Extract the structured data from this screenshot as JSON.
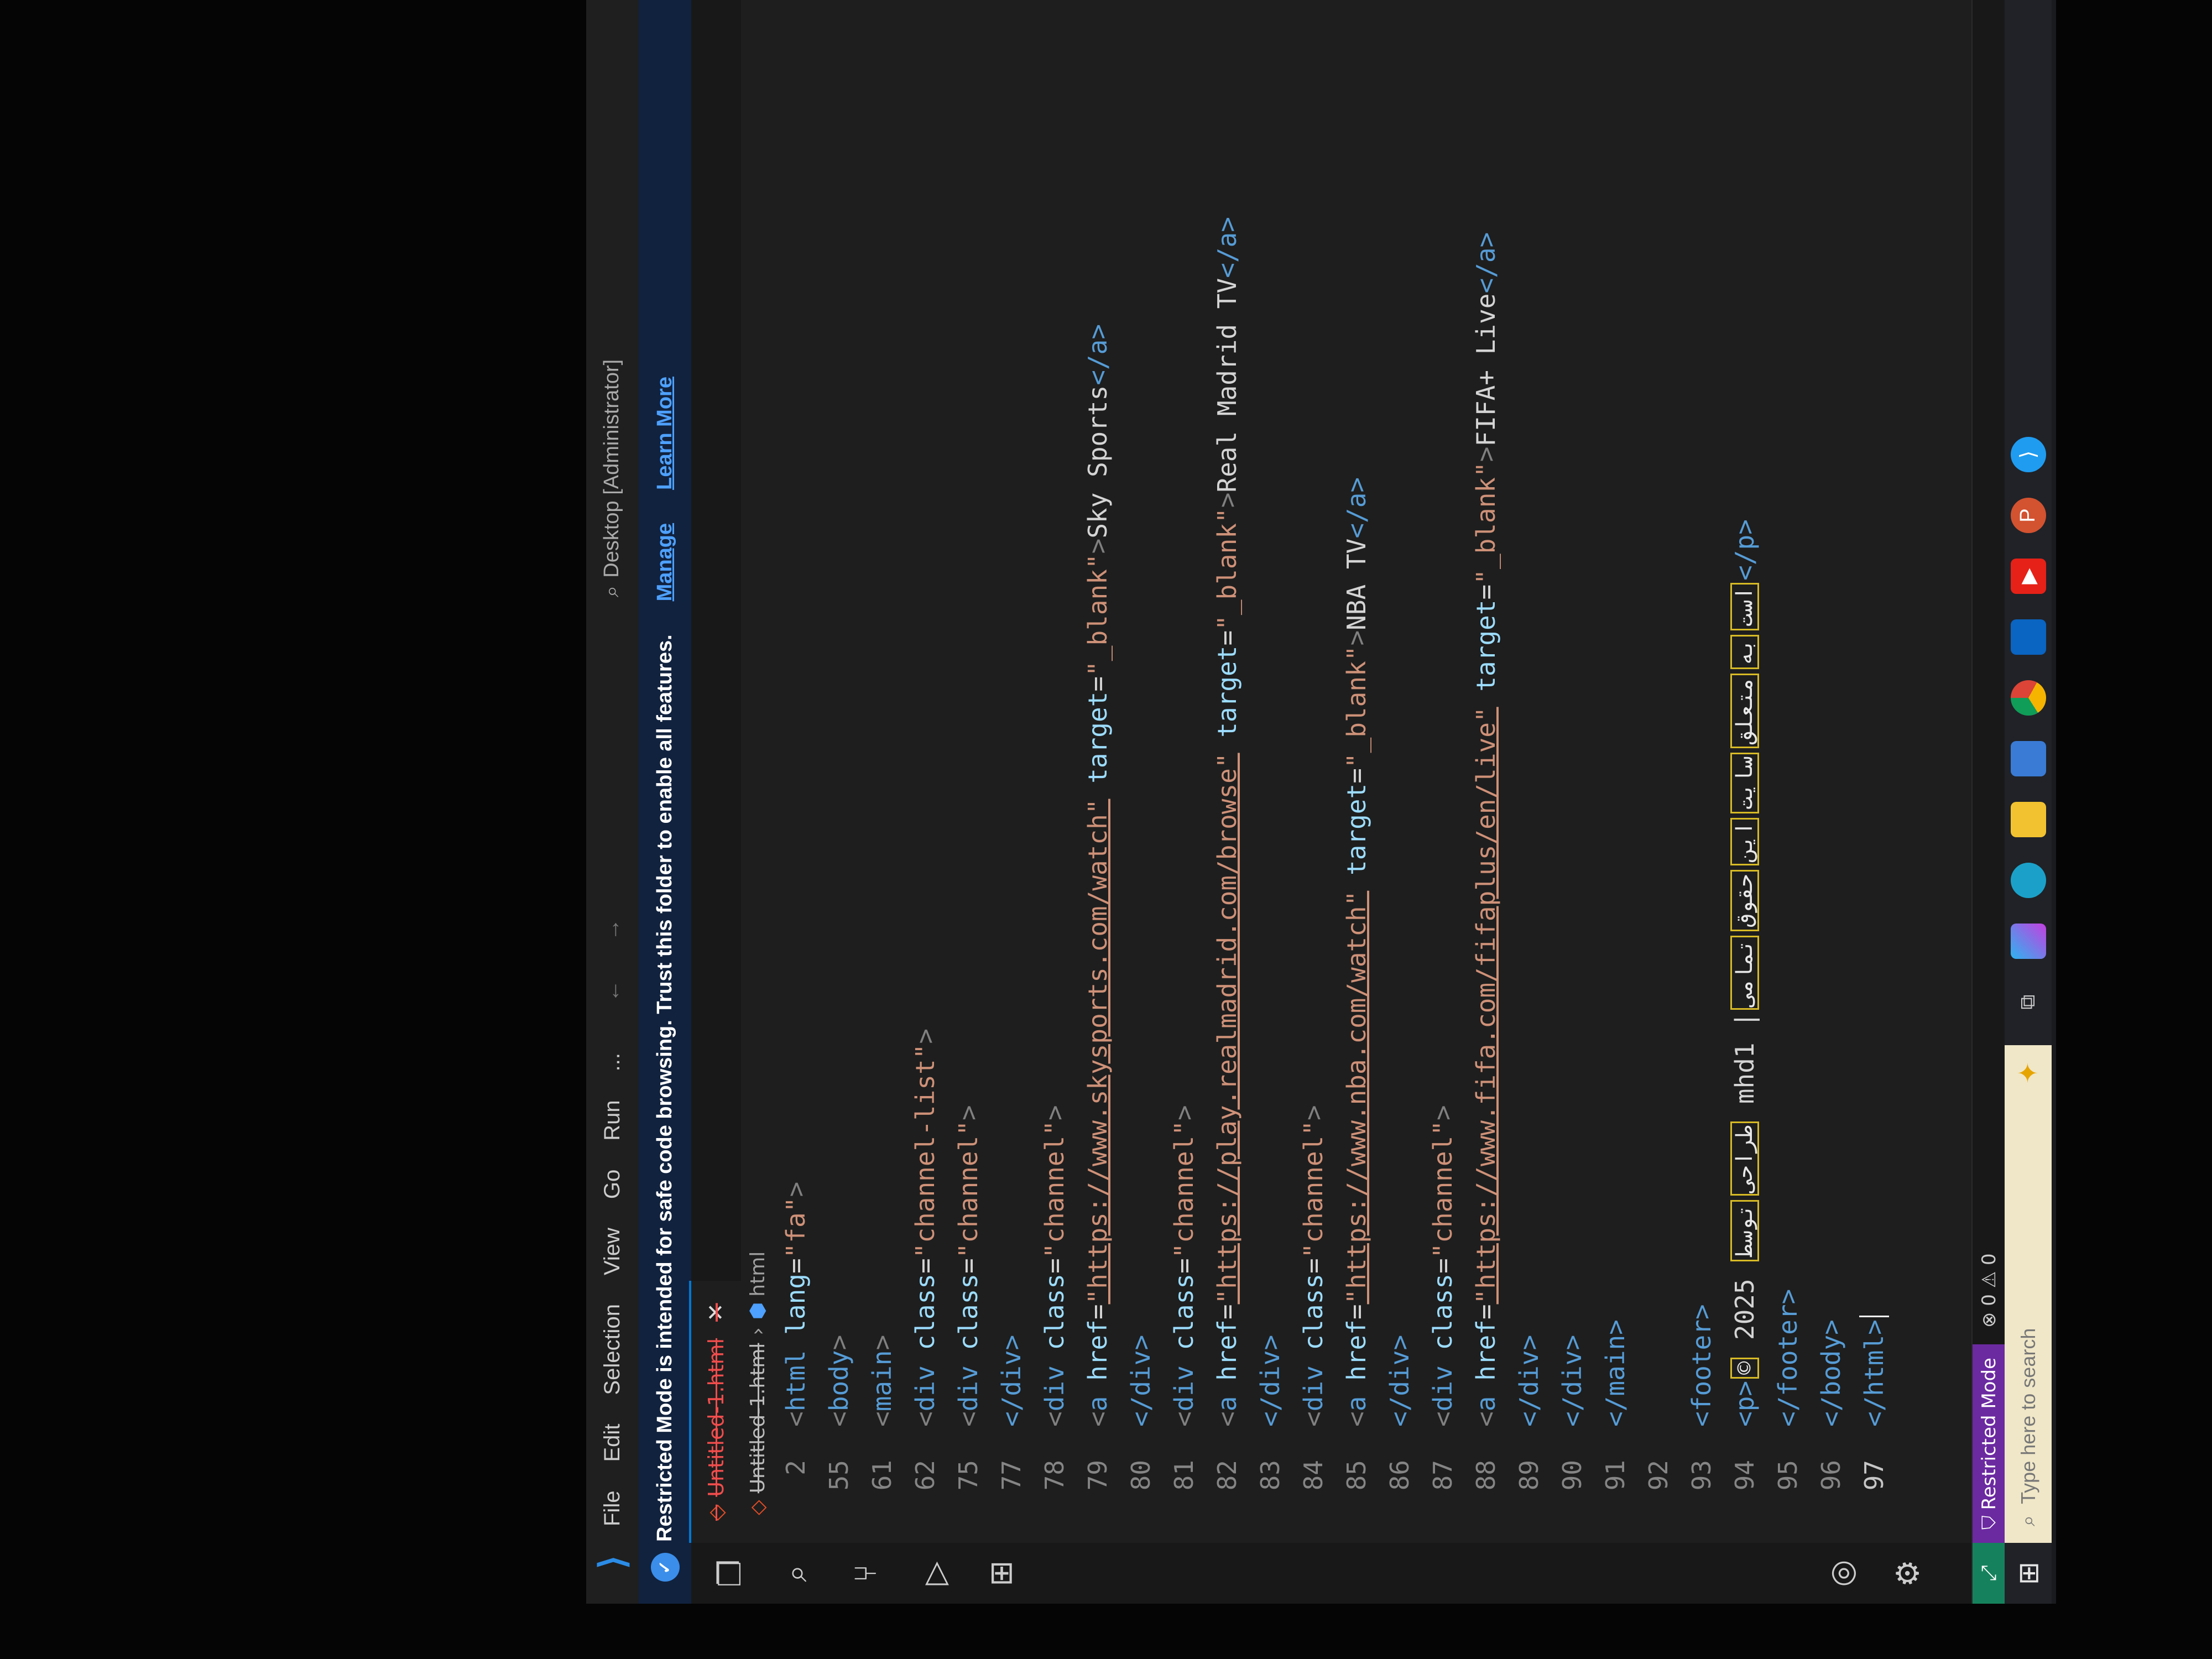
{
  "titlebar": {
    "menu": [
      "File",
      "Edit",
      "Selection",
      "View",
      "Go",
      "Run",
      "..."
    ],
    "nav_arrows": "← →",
    "search": "Desktop [Administrator]"
  },
  "banner": {
    "message": "Restricted Mode is intended for safe code browsing. Trust this folder to enable all features.",
    "manage": "Manage",
    "learn_more": "Learn More"
  },
  "activity_icons": [
    "explorer-icon",
    "search-icon",
    "source-control-icon",
    "run-debug-icon",
    "extensions-icon",
    "account-icon",
    "settings-icon"
  ],
  "editor": {
    "tab_label": "Untitled-1.html",
    "tab_close": "✕",
    "breadcrumb_file": "Untitled-1.html",
    "breadcrumb_sep": "›",
    "breadcrumb_node": "html"
  },
  "code": {
    "line_numbers": [
      "2",
      "55",
      "61",
      "62",
      "75",
      "77",
      "78",
      "79",
      "80",
      "81",
      "82",
      "83",
      "84",
      "85",
      "86",
      "87",
      "88",
      "89",
      "90",
      "91",
      "92",
      "93",
      "94",
      "95",
      "96",
      "97"
    ],
    "l2a": "<",
    "l2b": "html ",
    "l2c": "lang",
    "l2d": "=",
    "l2e": "\"fa\"",
    "l2f": ">",
    "l55a": "<",
    "l55b": "body",
    "l55c": ">",
    "l61a": "<",
    "l61b": "main",
    "l61c": ">",
    "l62a": "<",
    "l62b": "div ",
    "l62c": "class",
    "l62d": "=",
    "l62e": "\"channel-list\"",
    "l62f": ">",
    "l75a": "<",
    "l75b": "div ",
    "l75c": "class",
    "l75d": "=",
    "l75e": "\"channel\"",
    "l75f": ">",
    "close_div": "</div>",
    "l78a": "<",
    "l78b": "div ",
    "l78c": "class",
    "l78d": "=",
    "l78e": "\"channel\"",
    "l78f": ">",
    "l79_href": "\"https://www.skysports.com/watch\"",
    "l79_text": "Sky Sports",
    "l82_href": "\"https://play.realmadrid.com/browse\"",
    "l82_text": "Real Madrid TV",
    "l85_href": "\"https://www.nba.com/watch\"",
    "l85_text": "NBA TV",
    "l88_href": "\"https://www.fifa.com/fifaplus/en/live\"",
    "l88_text": "FIFA+ Live",
    "a_open": "<",
    "a_tag": "a ",
    "href_attr": "href",
    "eq": "=",
    "target_attr": " target",
    "target_val": "\"_blank\"",
    "gt": ">",
    "a_close": "</a>",
    "close_main": "</main>",
    "footer_open": "<footer>",
    "p_open": "<p>",
    "year": " 2025 ",
    "ar1": "توسط",
    "ar2": "طراحی",
    "author": " mhd1 ",
    "sep": "|",
    "ar3": "تمامی",
    "ar4": "حقوق",
    "ar5": "این",
    "ar6": "سایت",
    "ar7": "متعلق",
    "ar8": "به",
    "ar9": "است",
    "p_close": "</p>",
    "footer_close": "</footer>",
    "body_close": "</body>",
    "html_close": "</html>"
  },
  "statusbar": {
    "mode": "Restricted Mode",
    "problems": "⊗ 0 ⚠ 0"
  },
  "taskbar": {
    "search_placeholder": "Type here to search",
    "icons": [
      "task-view-icon",
      "copilot-icon",
      "edge-icon",
      "file-explorer-icon",
      "store-icon",
      "chrome-icon",
      "outlook-icon",
      "youtube-icon",
      "powerpoint-icon",
      "vscode-icon"
    ]
  }
}
